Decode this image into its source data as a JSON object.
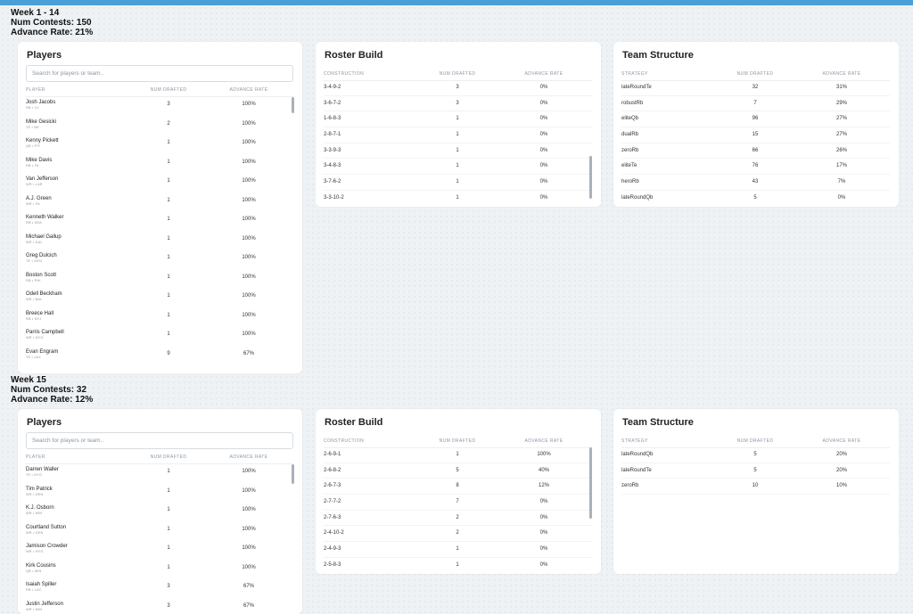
{
  "weeks": [
    {
      "header": {
        "title": "Week 1 - 14",
        "contests": "Num Contests: 150",
        "advance": "Advance Rate: 21%"
      },
      "players": {
        "title": "Players",
        "search_placeholder": "Search for players or team..",
        "columns": [
          "PLAYER",
          "NUM DRAFTED",
          "ADVANCE RATE"
        ],
        "rows": [
          {
            "name": "Josh Jacobs",
            "sub": "RB • LV",
            "drafted": "3",
            "rate": "100%"
          },
          {
            "name": "Mike Gesicki",
            "sub": "TE • NE",
            "drafted": "2",
            "rate": "100%"
          },
          {
            "name": "Kenny Pickett",
            "sub": "QB • PIT",
            "drafted": "1",
            "rate": "100%"
          },
          {
            "name": "Mike Davis",
            "sub": "RB • FA",
            "drafted": "1",
            "rate": "100%"
          },
          {
            "name": "Van Jefferson",
            "sub": "WR • LAR",
            "drafted": "1",
            "rate": "100%"
          },
          {
            "name": "A.J. Green",
            "sub": "WR • FA",
            "drafted": "1",
            "rate": "100%"
          },
          {
            "name": "Kenneth Walker",
            "sub": "RB • SEA",
            "drafted": "1",
            "rate": "100%"
          },
          {
            "name": "Michael Gallup",
            "sub": "WR • DAL",
            "drafted": "1",
            "rate": "100%"
          },
          {
            "name": "Greg Dulcich",
            "sub": "TE • DEN",
            "drafted": "1",
            "rate": "100%"
          },
          {
            "name": "Boston Scott",
            "sub": "RB • PHI",
            "drafted": "1",
            "rate": "100%"
          },
          {
            "name": "Odell Beckham",
            "sub": "WR • BAL",
            "drafted": "1",
            "rate": "100%"
          },
          {
            "name": "Breece Hall",
            "sub": "RB • NYJ",
            "drafted": "1",
            "rate": "100%"
          },
          {
            "name": "Parris Campbell",
            "sub": "WR • NYG",
            "drafted": "1",
            "rate": "100%"
          },
          {
            "name": "Evan Engram",
            "sub": "TE • JAX",
            "drafted": "9",
            "rate": "67%"
          }
        ]
      },
      "roster": {
        "title": "Roster Build",
        "columns": [
          "CONSTRUCTION",
          "NUM DRAFTED",
          "ADVANCE RATE"
        ],
        "rows": [
          {
            "construction": "3-4-9-2",
            "drafted": "3",
            "rate": "0%"
          },
          {
            "construction": "3-6-7-2",
            "drafted": "3",
            "rate": "0%"
          },
          {
            "construction": "1-6-8-3",
            "drafted": "1",
            "rate": "0%"
          },
          {
            "construction": "2-8-7-1",
            "drafted": "1",
            "rate": "0%"
          },
          {
            "construction": "3-3-9-3",
            "drafted": "1",
            "rate": "0%"
          },
          {
            "construction": "3-4-8-3",
            "drafted": "1",
            "rate": "0%"
          },
          {
            "construction": "3-7-6-2",
            "drafted": "1",
            "rate": "0%"
          },
          {
            "construction": "3-3-10-2",
            "drafted": "1",
            "rate": "0%"
          }
        ]
      },
      "team": {
        "title": "Team Structure",
        "columns": [
          "STRATEGY",
          "NUM DRAFTED",
          "ADVANCE RATE"
        ],
        "rows": [
          {
            "strategy": "lateRoundTe",
            "drafted": "32",
            "rate": "31%"
          },
          {
            "strategy": "robustRb",
            "drafted": "7",
            "rate": "29%"
          },
          {
            "strategy": "eliteQb",
            "drafted": "96",
            "rate": "27%"
          },
          {
            "strategy": "dualRb",
            "drafted": "15",
            "rate": "27%"
          },
          {
            "strategy": "zeroRb",
            "drafted": "66",
            "rate": "26%"
          },
          {
            "strategy": "eliteTe",
            "drafted": "76",
            "rate": "17%"
          },
          {
            "strategy": "heroRb",
            "drafted": "43",
            "rate": "7%"
          },
          {
            "strategy": "lateRoundQb",
            "drafted": "5",
            "rate": "0%"
          }
        ]
      }
    },
    {
      "header": {
        "title": "Week 15",
        "contests": "Num Contests: 32",
        "advance": "Advance Rate: 12%"
      },
      "players": {
        "title": "Players",
        "search_placeholder": "Search for players or team..",
        "columns": [
          "PLAYER",
          "NUM DRAFTED",
          "ADVANCE RATE"
        ],
        "rows": [
          {
            "name": "Darren Waller",
            "sub": "TE • NYG",
            "drafted": "1",
            "rate": "100%"
          },
          {
            "name": "Tim Patrick",
            "sub": "WR • DEN",
            "drafted": "1",
            "rate": "100%"
          },
          {
            "name": "K.J. Osborn",
            "sub": "WR • MIN",
            "drafted": "1",
            "rate": "100%"
          },
          {
            "name": "Courtland Sutton",
            "sub": "WR • DEN",
            "drafted": "1",
            "rate": "100%"
          },
          {
            "name": "Jamison Crowder",
            "sub": "WR • NYG",
            "drafted": "1",
            "rate": "100%"
          },
          {
            "name": "Kirk Cousins",
            "sub": "QB • MIN",
            "drafted": "1",
            "rate": "100%"
          },
          {
            "name": "Isaiah Spiller",
            "sub": "RB • LAC",
            "drafted": "3",
            "rate": "67%"
          },
          {
            "name": "Justin Jefferson",
            "sub": "WR • MIN",
            "drafted": "3",
            "rate": "67%"
          }
        ]
      },
      "roster": {
        "title": "Roster Build",
        "columns": [
          "CONSTRUCTION",
          "NUM DRAFTED",
          "ADVANCE RATE"
        ],
        "rows": [
          {
            "construction": "2-6-9-1",
            "drafted": "1",
            "rate": "100%"
          },
          {
            "construction": "2-6-8-2",
            "drafted": "5",
            "rate": "40%"
          },
          {
            "construction": "2-6-7-3",
            "drafted": "8",
            "rate": "12%"
          },
          {
            "construction": "2-7-7-2",
            "drafted": "7",
            "rate": "0%"
          },
          {
            "construction": "2-7-6-3",
            "drafted": "2",
            "rate": "0%"
          },
          {
            "construction": "2-4-10-2",
            "drafted": "2",
            "rate": "0%"
          },
          {
            "construction": "2-4-9-3",
            "drafted": "1",
            "rate": "0%"
          },
          {
            "construction": "2-5-8-3",
            "drafted": "1",
            "rate": "0%"
          }
        ]
      },
      "team": {
        "title": "Team Structure",
        "columns": [
          "STRATEGY",
          "NUM DRAFTED",
          "ADVANCE RATE"
        ],
        "rows": [
          {
            "strategy": "lateRoundQb",
            "drafted": "5",
            "rate": "20%"
          },
          {
            "strategy": "lateRoundTe",
            "drafted": "5",
            "rate": "20%"
          },
          {
            "strategy": "zeroRb",
            "drafted": "10",
            "rate": "10%"
          }
        ]
      }
    }
  ]
}
